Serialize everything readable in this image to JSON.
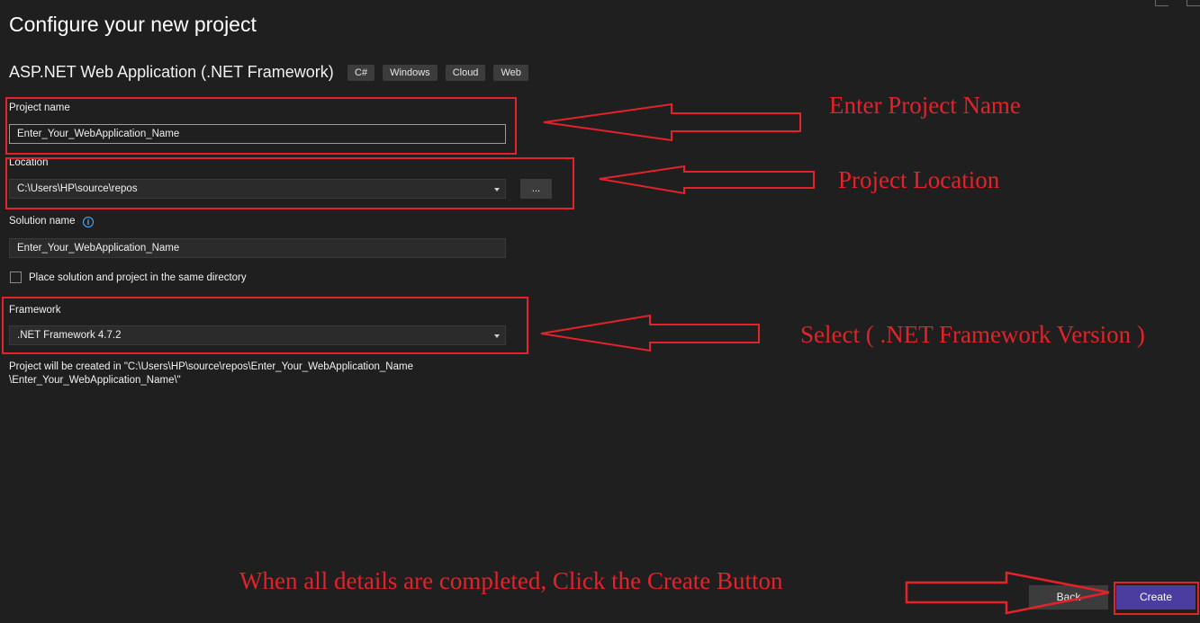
{
  "page": {
    "title": "Configure your new project",
    "template_name": "ASP.NET Web Application (.NET Framework)",
    "tags": [
      "C#",
      "Windows",
      "Cloud",
      "Web"
    ]
  },
  "form": {
    "project_name": {
      "label": "Project name",
      "value": "Enter_Your_WebApplication_Name"
    },
    "location": {
      "label": "Location",
      "value": "C:\\Users\\HP\\source\\repos",
      "browse_label": "..."
    },
    "solution_name": {
      "label": "Solution name",
      "value": "Enter_Your_WebApplication_Name"
    },
    "same_directory": {
      "label": "Place solution and project in the same directory",
      "checked": false
    },
    "framework": {
      "label": "Framework",
      "value": ".NET Framework 4.7.2"
    },
    "path_note_line1": "Project will be created in \"C:\\Users\\HP\\source\\repos\\Enter_Your_WebApplication_Name",
    "path_note_line2": "\\Enter_Your_WebApplication_Name\\\""
  },
  "buttons": {
    "back": "Back",
    "create": "Create"
  },
  "annotations": {
    "project_name": "Enter Project Name",
    "location": "Project Location",
    "framework": "Select  ( .NET Framework Version )",
    "create": "When all details are completed, Click the Create Button"
  },
  "colors": {
    "background": "#1f1f1f",
    "annotation_red": "#e3222a",
    "create_button": "#4b3ca0",
    "info_blue": "#4fb0ff"
  },
  "icons": [
    "info-icon",
    "chevron-down-icon",
    "checkbox-icon",
    "window-button-icon"
  ]
}
